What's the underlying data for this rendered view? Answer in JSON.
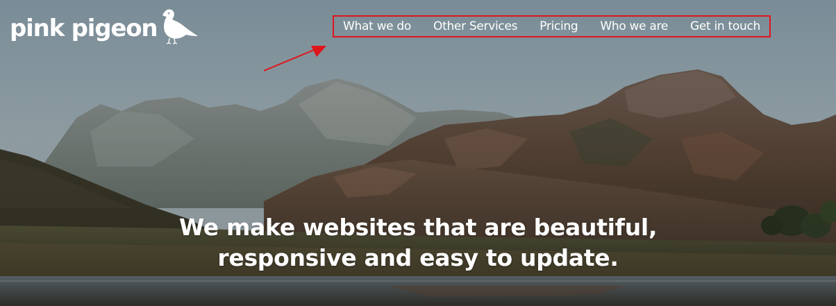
{
  "brand": {
    "name": "pink pigeon",
    "icon": "pigeon-icon"
  },
  "nav": {
    "items": [
      {
        "label": "What we do"
      },
      {
        "label": "Other Services"
      },
      {
        "label": "Pricing"
      },
      {
        "label": "Who we are"
      },
      {
        "label": "Get in touch"
      }
    ],
    "highlight_color": "#e0141b"
  },
  "hero": {
    "headline": "We make websites that are beautiful, responsive and easy to update."
  },
  "colors": {
    "text": "#ffffff",
    "annotation": "#e0141b"
  }
}
